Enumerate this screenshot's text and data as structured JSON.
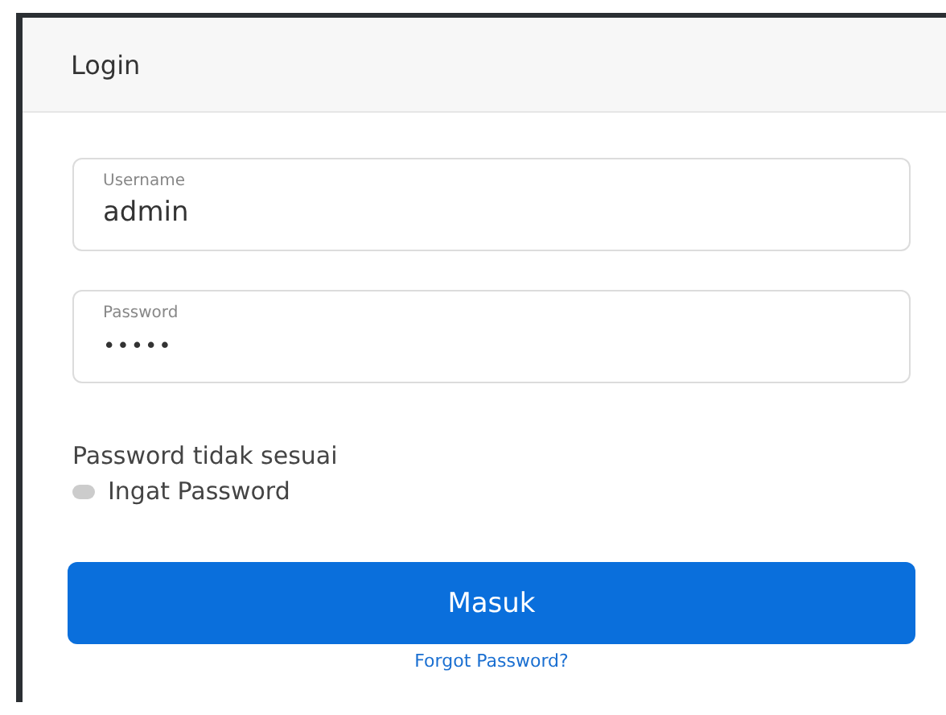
{
  "card": {
    "title": "Login"
  },
  "fields": [
    {
      "label": "Username",
      "value": "admin",
      "kind": "text"
    },
    {
      "label": "Password",
      "value": "•••••",
      "kind": "password"
    }
  ],
  "error": "Password tidak sesuai",
  "remember": {
    "label": "Ingat Password",
    "checked": false
  },
  "submit": "Masuk",
  "forgot": "Forgot Password?"
}
